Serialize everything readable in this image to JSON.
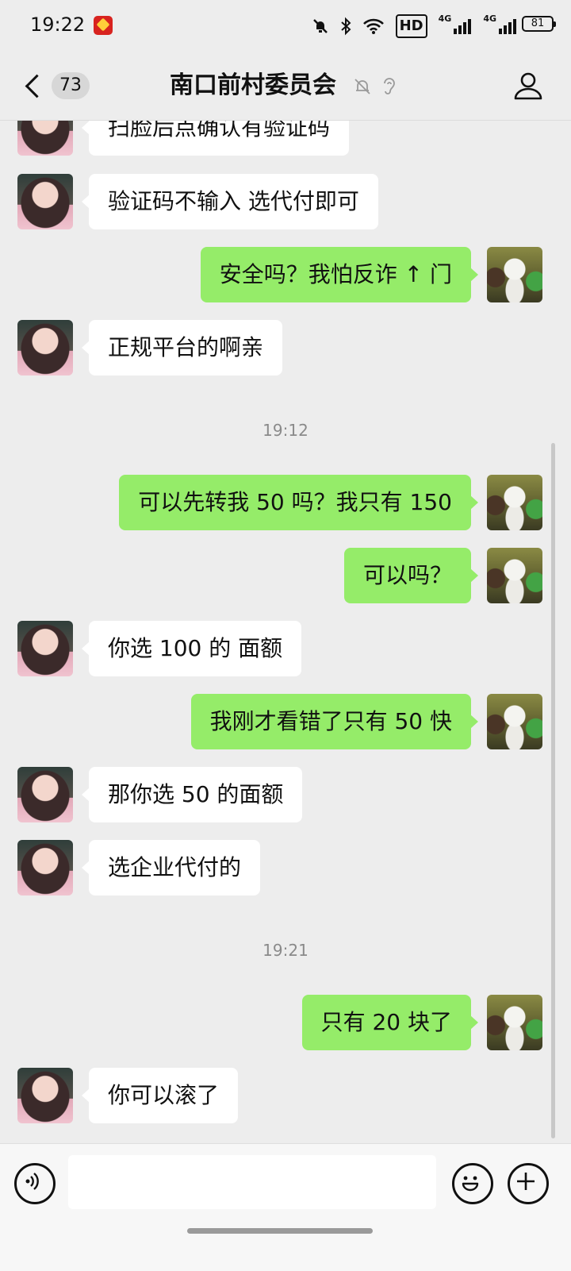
{
  "status_bar": {
    "time": "19:22",
    "hd_label": "HD",
    "signal_labels": [
      "4G",
      "4G"
    ],
    "battery": "81",
    "icons": [
      "app-notification-icon",
      "mute-icon",
      "bluetooth-icon",
      "wifi-icon",
      "hd-voice-icon",
      "signal-icon",
      "battery-icon"
    ]
  },
  "nav": {
    "unread_count": "73",
    "title": "南口前村委员会",
    "icons": [
      "back-chevron-icon",
      "mute-bell-icon",
      "ear-icon",
      "person-icon"
    ]
  },
  "messages": [
    {
      "side": "in",
      "text": "扫脸后点确认有验证码"
    },
    {
      "side": "in",
      "text": "验证码不输入 选代付即可"
    },
    {
      "side": "out",
      "text": "安全吗？我怕反诈 ↑ 门"
    },
    {
      "side": "in",
      "text": "正规平台的啊亲"
    },
    {
      "type": "time",
      "text": "19:12"
    },
    {
      "side": "out",
      "text": "可以先转我 50 吗？我只有 150"
    },
    {
      "side": "out",
      "text": "可以吗？"
    },
    {
      "side": "in",
      "text": "你选 100 的 面额"
    },
    {
      "side": "out",
      "text": "我刚才看错了只有 50 快"
    },
    {
      "side": "in",
      "text": "那你选 50 的面额"
    },
    {
      "side": "in",
      "text": "选企业代付的"
    },
    {
      "type": "time",
      "text": "19:21"
    },
    {
      "side": "out",
      "text": "只有 20 块了"
    },
    {
      "side": "in",
      "text": "你可以滚了"
    }
  ],
  "input_bar": {
    "text_value": "",
    "icons": [
      "voice-icon",
      "emoji-icon",
      "plus-icon"
    ]
  },
  "colors": {
    "background": "#ededed",
    "outgoing_bubble": "#95ec69",
    "incoming_bubble": "#ffffff",
    "timestamp_text": "#8a8a8a"
  }
}
